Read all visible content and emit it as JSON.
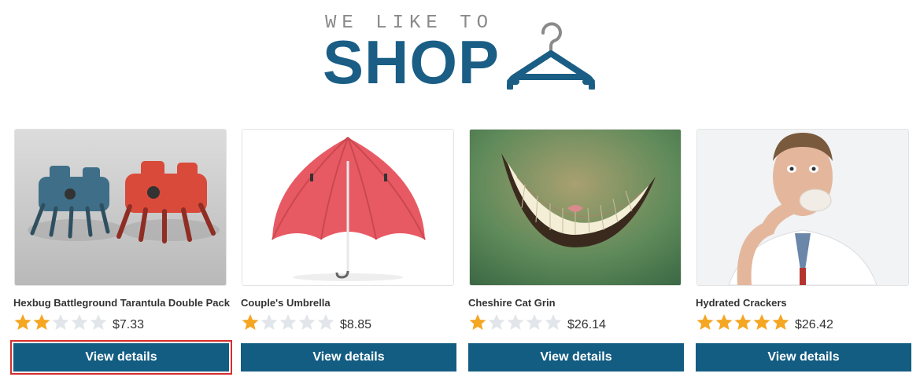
{
  "header": {
    "tagline": "WE LIKE TO",
    "brand": "SHOP"
  },
  "colors": {
    "brand": "#1a5e85",
    "button": "#135d82",
    "star_on": "#f5a623",
    "star_off": "#e2e6ea",
    "focus": "#d32f2f"
  },
  "products": [
    {
      "title": "Hexbug Battleground Tarantula Double Pack",
      "rating": 2,
      "price": "$7.33",
      "button": "View details",
      "image_icon": "robot-spiders-image"
    },
    {
      "title": "Couple's Umbrella",
      "rating": 1,
      "price": "$8.85",
      "button": "View details",
      "image_icon": "umbrella-image"
    },
    {
      "title": "Cheshire Cat Grin",
      "rating": 1,
      "price": "$26.14",
      "button": "View details",
      "image_icon": "cat-grin-image"
    },
    {
      "title": "Hydrated Crackers",
      "rating": 5,
      "price": "$26.42",
      "button": "View details",
      "image_icon": "man-eating-crackers-image"
    }
  ]
}
